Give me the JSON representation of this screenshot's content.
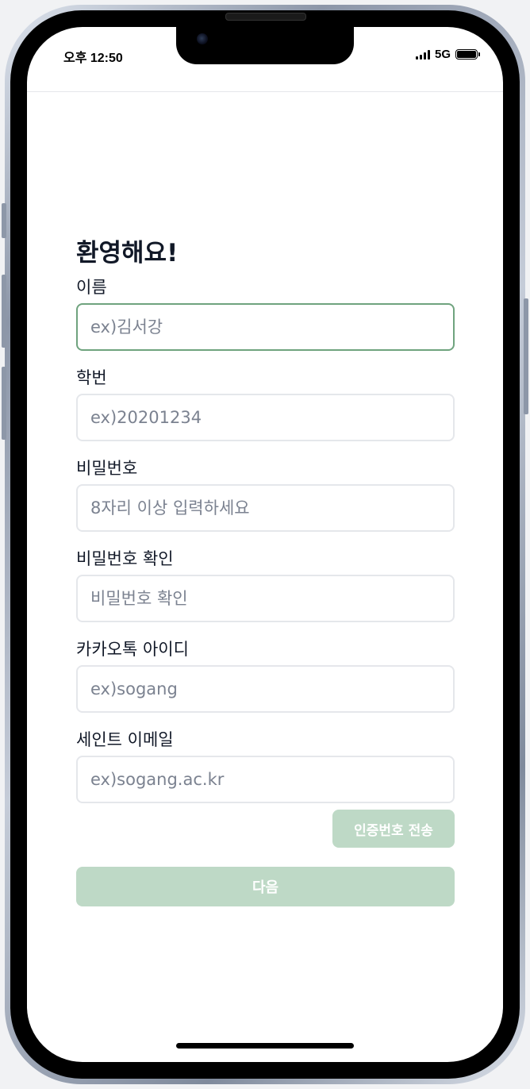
{
  "status_bar": {
    "time": "오후 12:50",
    "network": "5G",
    "battery_level": 1.0
  },
  "form": {
    "title": "환영해요!",
    "fields": [
      {
        "label": "이름",
        "placeholder": "ex)김서강",
        "value": ""
      },
      {
        "label": "학번",
        "placeholder": "ex)20201234",
        "value": ""
      },
      {
        "label": "비밀번호",
        "placeholder": "8자리 이상 입력하세요",
        "value": ""
      },
      {
        "label": "비밀번호 확인",
        "placeholder": "비밀번호 확인",
        "value": ""
      },
      {
        "label": "카카오톡 아이디",
        "placeholder": "ex)sogang",
        "value": ""
      },
      {
        "label": "세인트 이메일",
        "placeholder": "ex)sogang.ac.kr",
        "value": ""
      }
    ],
    "send_code_label": "인증번호 전송",
    "next_label": "다음"
  },
  "colors": {
    "accent": "#6fa37e",
    "button_disabled": "#bed9c6",
    "input_border": "#e5e7eb",
    "text": "#111827"
  }
}
